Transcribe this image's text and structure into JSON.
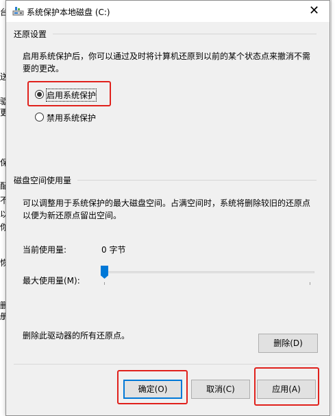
{
  "background_fragments": [
    "台",
    "送",
    "驱",
    "册",
    "更",
    "保",
    "不",
    "以",
    "你",
    "恢",
    "配",
    "删"
  ],
  "dialog": {
    "title": "系统保护本地磁盘 (C:)",
    "close_glyph": "✕",
    "restore_settings": {
      "group_label": "还原设置",
      "description": "启用系统保护后，你可以通过及时将计算机还原到以前的某个状态点来撤消不需要的更改。",
      "options": [
        {
          "label": "启用系统保护",
          "checked": true
        },
        {
          "label": "禁用系统保护",
          "checked": false
        }
      ]
    },
    "disk_usage": {
      "group_label": "磁盘空间使用量",
      "description": "可以调整用于系统保护的最大磁盘空间。占满空间时，系统将删除较旧的还原点以便为新还原点留出空间。",
      "current_usage_label": "当前使用量:",
      "current_usage_value": "0 字节",
      "max_usage_label": "最大使用量(M):",
      "max_usage_fraction": 0.0
    },
    "delete_text": "删除此驱动器的所有还原点。",
    "delete_button": "删除(D)",
    "buttons": {
      "ok": "确定(O)",
      "cancel": "取消(C)",
      "apply": "应用(A)"
    },
    "highlight_color": "#e0201b",
    "accent_color": "#0078d7"
  }
}
